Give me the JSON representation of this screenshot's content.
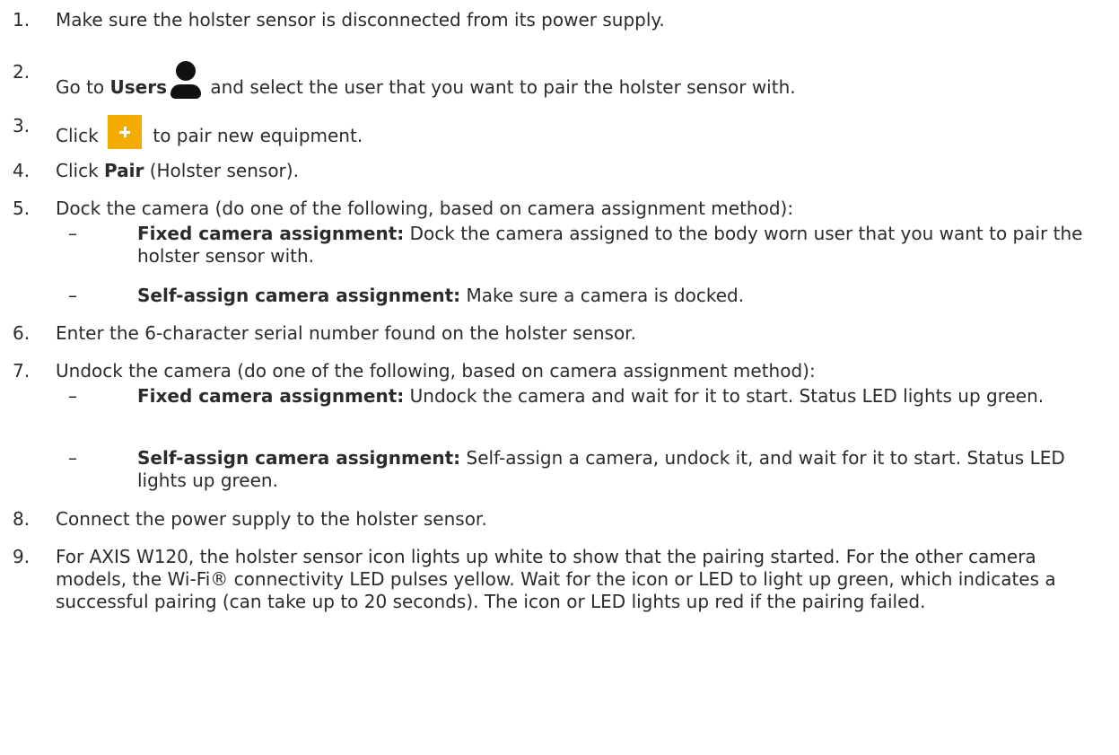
{
  "steps": [
    {
      "num": "1.",
      "text": "Make sure the holster sensor is disconnected from its power supply."
    },
    {
      "num": "2.",
      "prefix": "Go to ",
      "bold": "Users",
      "suffix": " and select the user that you want to pair the holster sensor with.",
      "icon": "user-icon"
    },
    {
      "num": "3.",
      "prefix": "Click ",
      "suffix": " to pair new equipment.",
      "icon": "plus-icon"
    },
    {
      "num": "4.",
      "prefix": "Click ",
      "bold": "Pair",
      "suffix": " (Holster sensor)."
    },
    {
      "num": "5.",
      "text": "Dock the camera (do one of the following, based on camera assignment method):"
    },
    {
      "num": "6.",
      "text": "Enter the 6-character serial number found on the holster sensor."
    },
    {
      "num": "7.",
      "text": "Undock the camera (do one of the following, based on camera assignment method):"
    },
    {
      "num": "8.",
      "text": "Connect the power supply to the holster sensor."
    },
    {
      "num": "9.",
      "text": "For AXIS W120, the holster sensor icon lights up white to show that the pairing started. For the other camera models, the Wi-Fi® connectivity LED pulses yellow. Wait for the icon or LED to light up green, which indicates a successful pairing (can take up to 20 seconds). The icon or LED lights up red if the pairing failed."
    }
  ],
  "substeps": [
    {
      "dash": "–",
      "bold": "Fixed camera assignment:",
      "text": " Dock the camera assigned to the body worn user that you want to pair the holster sensor with."
    },
    {
      "dash": "–",
      "bold": "Self-assign camera assignment:",
      "text": " Make sure a camera is docked."
    },
    {
      "dash": "–",
      "bold": "Fixed camera assignment:",
      "text": " Undock the camera and wait for it to start. Status LED lights up green."
    },
    {
      "dash": "–",
      "bold": "Self-assign camera assignment:",
      "text": " Self-assign a camera, undock it, and wait for it to start. Status LED lights up green."
    }
  ],
  "colors": {
    "text": "#2b2b2b",
    "plus_button": "#f4ab00",
    "user_icon": "#111111"
  }
}
